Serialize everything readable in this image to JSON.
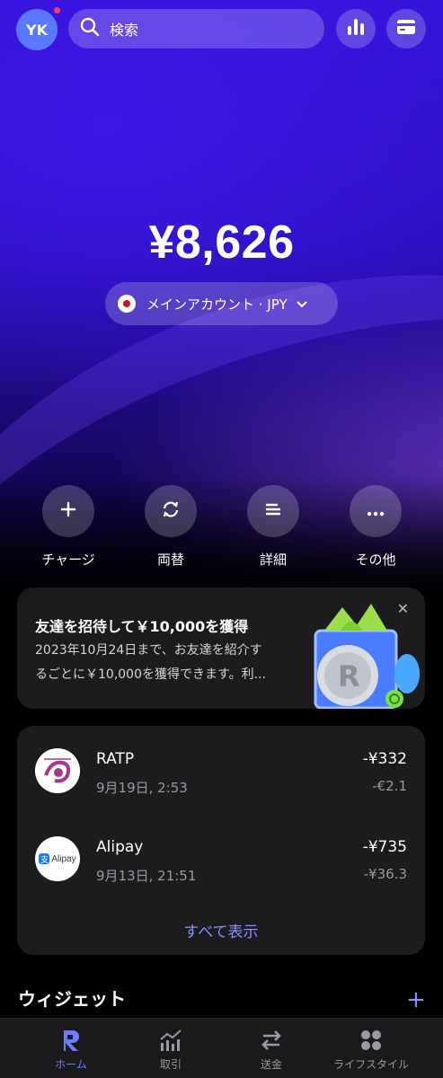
{
  "header": {
    "avatar_initials": "YK",
    "search_placeholder": "検索",
    "icons": [
      "search-icon",
      "analytics-icon",
      "card-icon"
    ]
  },
  "balance": {
    "amount": "¥8,626",
    "account_label": "メインアカウント · JPY"
  },
  "actions": [
    {
      "label": "チャージ",
      "icon": "plus-icon"
    },
    {
      "label": "両替",
      "icon": "exchange-icon"
    },
    {
      "label": "詳細",
      "icon": "details-icon"
    },
    {
      "label": "その他",
      "icon": "more-icon"
    }
  ],
  "promo": {
    "title": "友達を招待して￥10,000を獲得",
    "line1": "2023年10月24日まで、お友達を紹介す",
    "line2": "るごとに￥10,000を獲得できます。利..."
  },
  "transactions": [
    {
      "name": "RATP",
      "date": "9月19日, 2:53",
      "amount": "-¥332",
      "sub_amount": "-€2.1"
    },
    {
      "name": "Alipay",
      "date": "9月13日, 21:51",
      "amount": "-¥735",
      "sub_amount": "-¥36.3"
    }
  ],
  "alipay_logo_text": "Alipay",
  "see_all": "すべて表示",
  "widgets": {
    "title": "ウィジェット"
  },
  "nav": [
    {
      "label": "ホーム",
      "active": true
    },
    {
      "label": "取引",
      "active": false
    },
    {
      "label": "送金",
      "active": false
    },
    {
      "label": "ライフスタイル",
      "active": false
    }
  ],
  "colors": {
    "accent": "#6f7bff",
    "hero": "#3412d8",
    "card": "#1c1c1e"
  }
}
